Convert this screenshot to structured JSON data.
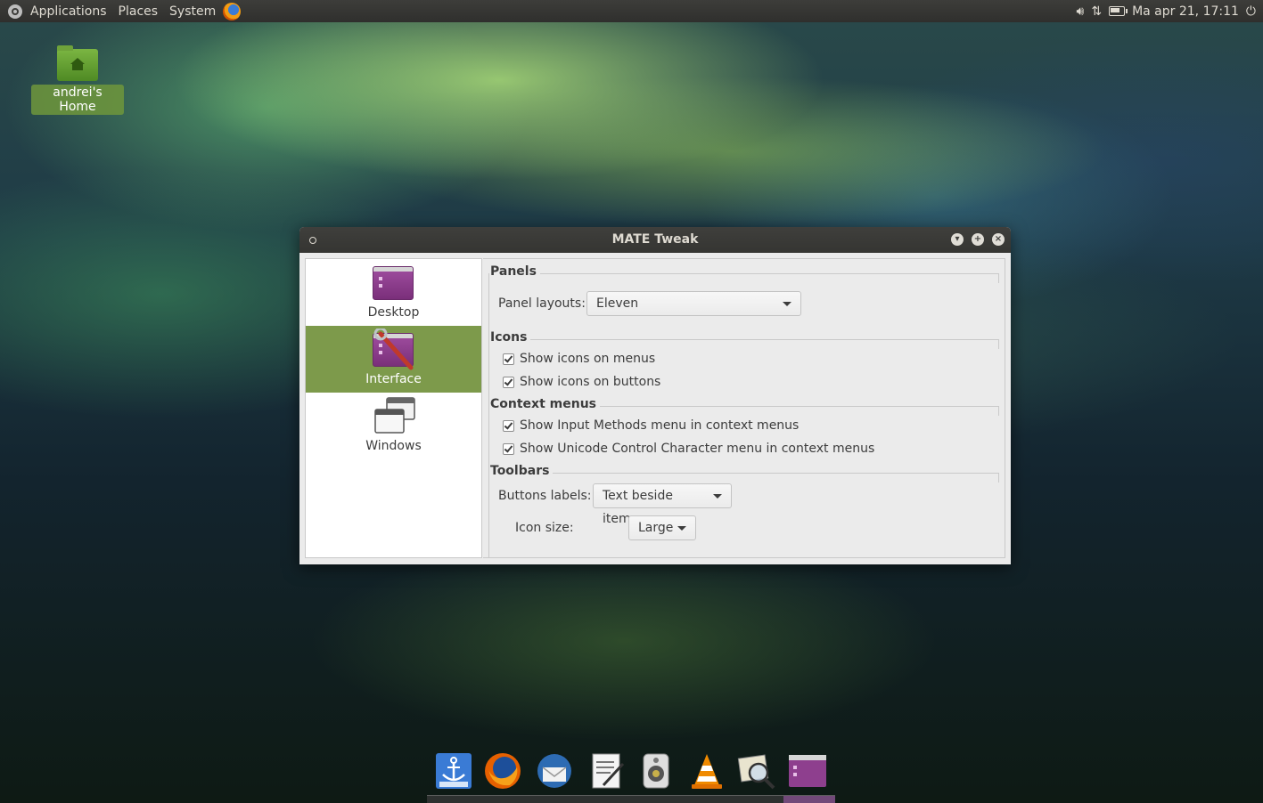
{
  "top_panel": {
    "menus": [
      "Applications",
      "Places",
      "System"
    ],
    "clock": "Ma apr 21, 17:11",
    "icons": [
      "mate-logo-icon",
      "firefox-icon",
      "volume-icon",
      "network-icon",
      "battery-icon",
      "power-icon"
    ],
    "battery_level": 0.8
  },
  "desktop": {
    "home_label": "andrei's Home"
  },
  "window": {
    "title": "MATE Tweak",
    "sidebar": [
      {
        "label": "Desktop",
        "selected": false
      },
      {
        "label": "Interface",
        "selected": true
      },
      {
        "label": "Windows",
        "selected": false
      }
    ],
    "panels": {
      "title": "Panels",
      "layout_label": "Panel layouts:",
      "layout_value": "Eleven"
    },
    "icons": {
      "title": "Icons",
      "options": [
        "Show icons on menus",
        "Show icons on buttons"
      ]
    },
    "context_menus": {
      "title": "Context menus",
      "options": [
        "Show Input Methods menu in context menus",
        "Show Unicode Control Character menu in context menus"
      ]
    },
    "toolbars": {
      "title": "Toolbars",
      "buttons_label": "Buttons labels:",
      "buttons_value": "Text beside items",
      "icon_size_label": "Icon size:",
      "icon_size_value": "Large"
    }
  },
  "dock": {
    "apps": [
      "anchor-dock-icon",
      "firefox-icon",
      "thunderbird-icon",
      "text-editor-icon",
      "speaker-icon",
      "vlc-icon",
      "image-viewer-icon",
      "mate-tweak-icon"
    ]
  },
  "colors": {
    "selection": "#7d9a4b",
    "panel": "#3d3d3a",
    "accent_purple": "#8e3f8e"
  }
}
